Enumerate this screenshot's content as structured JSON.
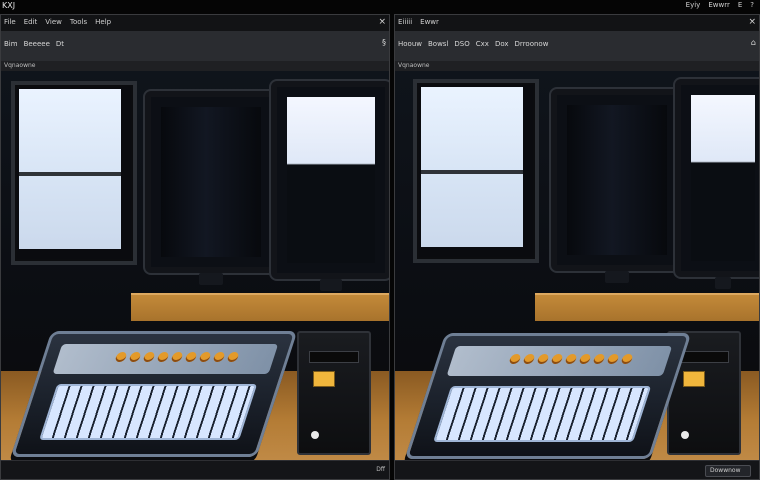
{
  "topbar": {
    "title": "KXJ",
    "right_items": [
      "Eyiy",
      "Ewwrr",
      "E",
      "?"
    ]
  },
  "left_pane": {
    "menu": [
      "File",
      "Edit",
      "View",
      "Tools",
      "Help"
    ],
    "toolbar": [
      "Bim",
      "Beeeee",
      "Dt"
    ],
    "toolbar_right_icon": "§",
    "statusline": "Vqnaowne",
    "bottom_right_text": "Dff"
  },
  "right_pane": {
    "menu": [
      "Eiiiii",
      "Ewwr"
    ],
    "toolbar": [
      "Hoouw",
      "Bowsl",
      "DSO",
      "Cxx",
      "Dox",
      "Drroonow"
    ],
    "toolbar_right_icon": "⌂",
    "statusline": "Vqnaowne",
    "bottom_right_text": "Dowwnow"
  },
  "icons": {
    "close": "close-icon",
    "toolbar_icon": "toolbar-icon"
  }
}
